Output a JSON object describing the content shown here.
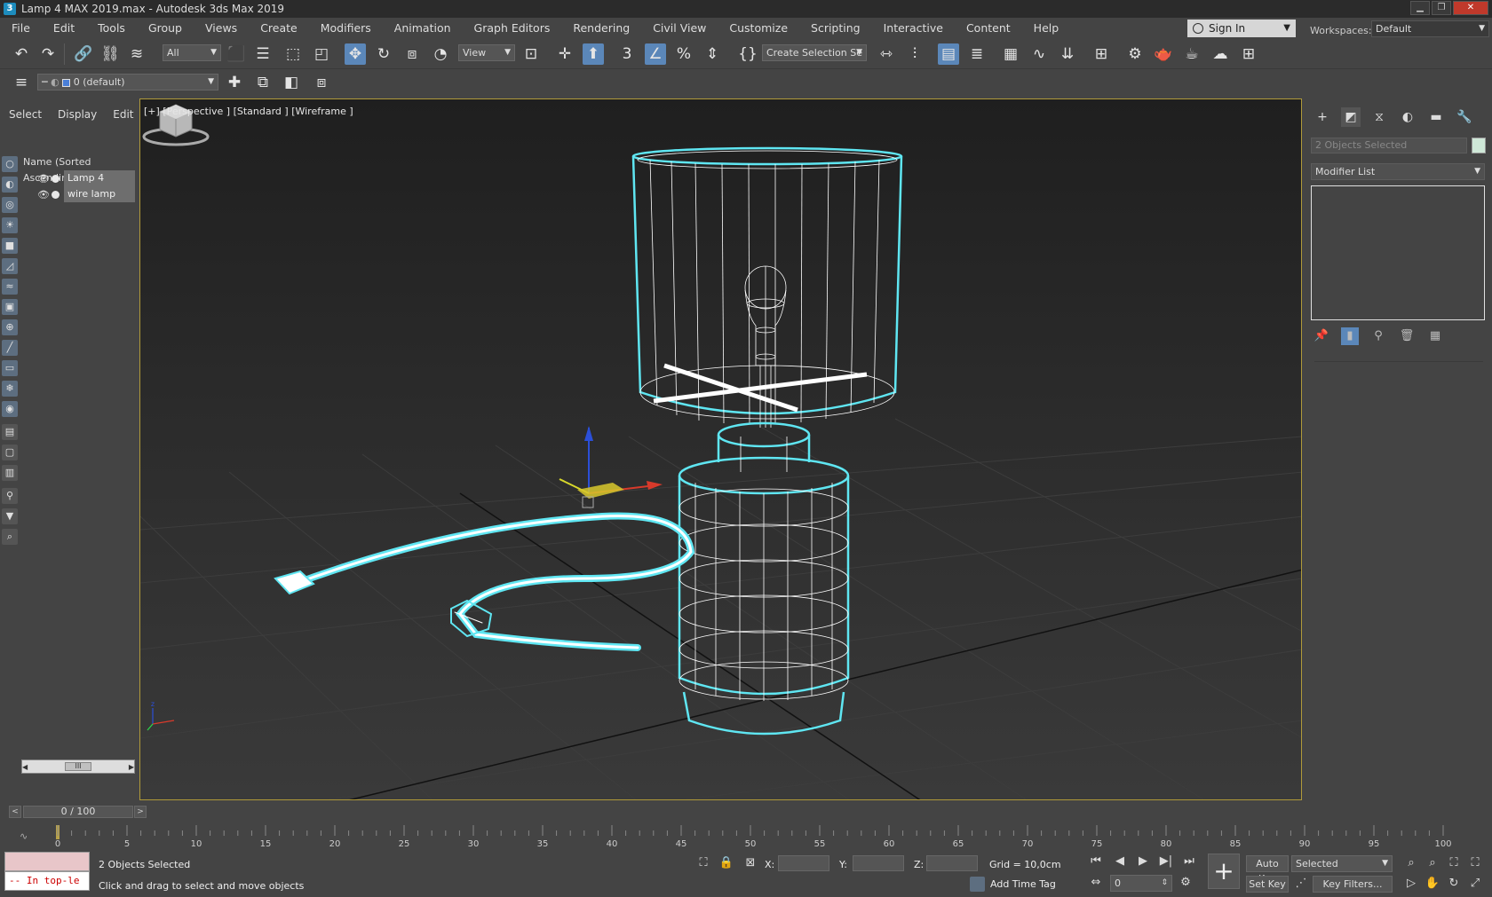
{
  "window": {
    "title": "Lamp 4 MAX 2019.max - Autodesk 3ds Max 2019",
    "minimize": "▁",
    "restore": "❐",
    "close": "✕"
  },
  "menu": [
    "File",
    "Edit",
    "Tools",
    "Group",
    "Views",
    "Create",
    "Modifiers",
    "Animation",
    "Graph Editors",
    "Rendering",
    "Civil View",
    "Customize",
    "Scripting",
    "Interactive",
    "Content",
    "Help"
  ],
  "signin": {
    "label": "Sign In"
  },
  "workspaces": {
    "label": "Workspaces:",
    "value": "Default"
  },
  "toolbar": {
    "selection_filter": "All",
    "ref_coord": "View",
    "named_selection": "Create Selection Se"
  },
  "layer_toolbar": {
    "layer": "0 (default)"
  },
  "explorer": {
    "tabs": [
      "Select",
      "Display",
      "Edit"
    ],
    "column_header": "Name (Sorted Ascending)",
    "items": [
      {
        "label": "Lamp 4"
      },
      {
        "label": "wire lamp"
      }
    ],
    "scroll_thumb": "III"
  },
  "viewport": {
    "label": "[+] [Perspective ] [Standard ] [Wireframe ]",
    "wire_color": "#5fe6f2"
  },
  "command_panel": {
    "object_name": "2 Objects Selected",
    "modifier_list": "Modifier List"
  },
  "timeslider": {
    "value": "0 / 100",
    "ticks": [
      "0",
      "5",
      "10",
      "15",
      "20",
      "25",
      "30",
      "35",
      "40",
      "45",
      "50",
      "55",
      "60",
      "65",
      "70",
      "75",
      "80",
      "85",
      "90",
      "95",
      "100"
    ]
  },
  "status": {
    "maxscript_line": "-- In top-le",
    "selection": "2 Objects Selected",
    "prompt": "Click and drag to select and move objects",
    "x_label": "X:",
    "y_label": "Y:",
    "z_label": "Z:",
    "grid": "Grid = 10,0cm",
    "add_time_tag": "Add Time Tag",
    "auto_key": "Auto Key",
    "set_key": "Set Key",
    "key_mode": "Selected",
    "frame": "0",
    "key_filters": "Key Filters..."
  }
}
